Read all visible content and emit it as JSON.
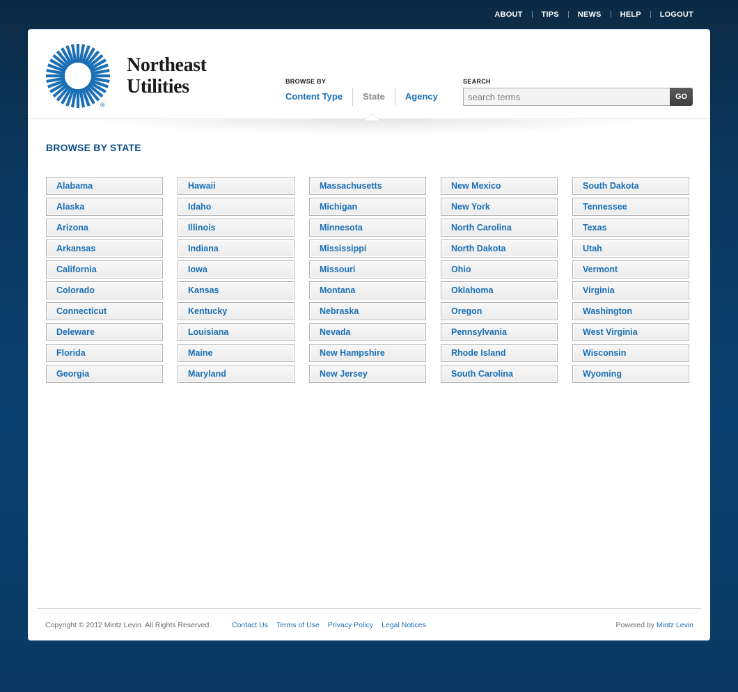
{
  "top_nav": [
    "ABOUT",
    "TIPS",
    "NEWS",
    "HELP",
    "LOGOUT"
  ],
  "brand": {
    "line1": "Northeast",
    "line2": "Utilities",
    "logo_icon": "sunburst-logo-icon",
    "accent": "#1a6fb5"
  },
  "browse": {
    "label": "BROWSE BY",
    "tabs": [
      {
        "label": "Content Type",
        "active": false
      },
      {
        "label": "State",
        "active": true
      },
      {
        "label": "Agency",
        "active": false
      }
    ]
  },
  "search": {
    "label": "SEARCH",
    "placeholder": "search terms",
    "button": "GO"
  },
  "page_title": "BROWSE BY STATE",
  "states": [
    [
      "Alabama",
      "Alaska",
      "Arizona",
      "Arkansas",
      "California",
      "Colorado",
      "Connecticut",
      "Deleware",
      "Florida",
      "Georgia"
    ],
    [
      "Hawaii",
      "Idaho",
      "Illinois",
      "Indiana",
      "Iowa",
      "Kansas",
      "Kentucky",
      "Louisiana",
      "Maine",
      "Maryland"
    ],
    [
      "Massachusetts",
      "Michigan",
      "Minnesota",
      "Mississippi",
      "Missouri",
      "Montana",
      "Nebraska",
      "Nevada",
      "New Hampshire",
      "New Jersey"
    ],
    [
      "New Mexico",
      "New York",
      "North Carolina",
      "North Dakota",
      "Ohio",
      "Oklahoma",
      "Oregon",
      "Pennsylvania",
      "Rhode Island",
      "South Carolina"
    ],
    [
      "South Dakota",
      "Tennessee",
      "Texas",
      "Utah",
      "Vermont",
      "Virginia",
      "Washington",
      "West Virginia",
      "Wisconsin",
      "Wyoming"
    ]
  ],
  "footer": {
    "copyright": "Copyright © 2012 Mintz Levin. All Rights Reserved.",
    "links": [
      "Contact Us",
      "Terms of Use",
      "Privacy Policy",
      "Legal Notices"
    ],
    "powered_by": "Powered by",
    "powered_by_link": "Mintz Levin"
  }
}
